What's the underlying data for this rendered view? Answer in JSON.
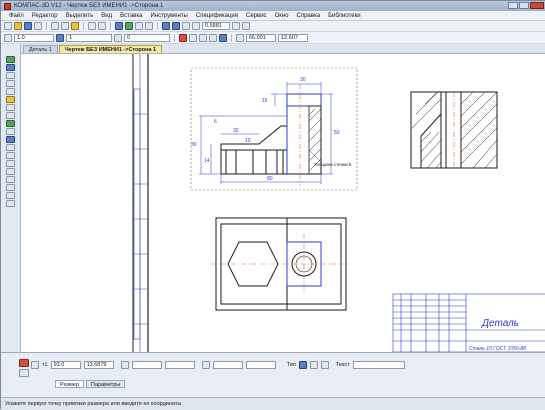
{
  "window": {
    "title": "КОМПАС-3D V12 - Чертеж БЕЗ ИМЕНИ1 ->Сторона 1"
  },
  "menu": [
    "Файл",
    "Редактор",
    "Выделить",
    "Вид",
    "Вставка",
    "Инструменты",
    "Спецификация",
    "Сервис",
    "Окно",
    "Справка",
    "Библиотеки"
  ],
  "toolbar2": {
    "scale": "1.0",
    "layer": "1",
    "step": "0",
    "zoom": "0.5881",
    "coord_x": "66.991",
    "coord_y": "12.607"
  },
  "tabs": [
    {
      "label": "Деталь 1"
    },
    {
      "label": "Чертеж БЕЗ ИМЕНИ1 ->Сторона 1",
      "active": true
    }
  ],
  "drawing": {
    "dims": {
      "d1": "30",
      "d2": "16",
      "d3": "32",
      "d4": "30",
      "d5": "14",
      "d6": "6",
      "d7": "50",
      "d8": "80",
      "d9": "10"
    },
    "callout": "Толщина стенки 5",
    "title_block": {
      "name": "Деталь",
      "material": "Сталь 10 ГОСТ 1050-88"
    }
  },
  "props": {
    "t1_label": "т1",
    "t1_x": "93.0",
    "t1_y": "13.6879",
    "type_label": "Тип",
    "text_label": "Текст",
    "text_value": ""
  },
  "panel_tabs": [
    "Размер",
    "Параметры"
  ],
  "status": "Укажите первую точку привязки размера или введите ее координаты"
}
